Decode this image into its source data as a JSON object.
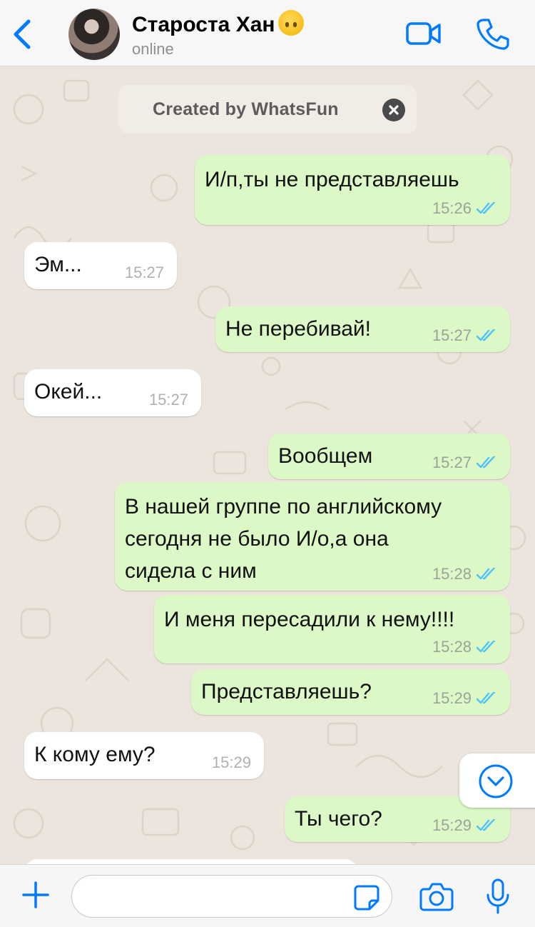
{
  "header": {
    "contact_name": "Староста Хан",
    "status": "online"
  },
  "banner": {
    "text": "Created by WhatsFun"
  },
  "messages": [
    {
      "direction": "out",
      "text": "И/п,ты не представляешь",
      "time": "15:26"
    },
    {
      "direction": "in",
      "text": "Эм...",
      "time": "15:27"
    },
    {
      "direction": "out",
      "text": "Не перебивай!",
      "time": "15:27"
    },
    {
      "direction": "in",
      "text": "Окей...",
      "time": "15:27"
    },
    {
      "direction": "out",
      "text": "Вообщем",
      "time": "15:27"
    },
    {
      "direction": "out",
      "text": "В нашей группе по английскому\nсегодня не было И/о,а она\nсидела с ним",
      "time": "15:28"
    },
    {
      "direction": "out",
      "text": "И меня пересадили к нему!!!!",
      "time": "15:28"
    },
    {
      "direction": "out",
      "text": "Представляешь?",
      "time": "15:29"
    },
    {
      "direction": "in",
      "text": "К кому ему?",
      "time": "15:29"
    },
    {
      "direction": "out",
      "text": "Ты чего?",
      "time": "15:29"
    }
  ],
  "composer": {
    "placeholder": "",
    "value": ""
  },
  "colors": {
    "accent": "#007aff",
    "outgoing_bubble": "#dcf8c6",
    "incoming_bubble": "#ffffff",
    "chat_background": "#ece5dd",
    "read_ticks": "#4fc3f7"
  },
  "icons": {
    "back": "chevron-left-icon",
    "video": "video-camera-icon",
    "call": "phone-icon",
    "banner_close": "close-icon",
    "scroll_down": "chevron-down-circle-icon",
    "attach": "plus-icon",
    "sticker": "sticker-icon",
    "camera": "camera-icon",
    "mic": "microphone-icon"
  }
}
